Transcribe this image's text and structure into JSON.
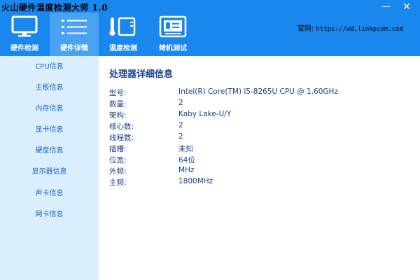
{
  "app": {
    "title": "火山硬件温度检测大师 1.0"
  },
  "window_controls": {
    "minimize": "—",
    "close": "✕"
  },
  "nav": {
    "tabs": [
      {
        "label": "硬件检测",
        "icon": "monitor-icon",
        "active": false
      },
      {
        "label": "硬件详情",
        "icon": "list-icon",
        "active": true
      },
      {
        "label": "温度检测",
        "icon": "thermometer-icon",
        "active": false
      },
      {
        "label": "烤机测试",
        "icon": "circuit-board-icon",
        "active": false
      }
    ]
  },
  "website": {
    "label": "官网:",
    "url": "https://wd.linkpcem.com"
  },
  "sidebar": {
    "items": [
      {
        "label": "CPU信息"
      },
      {
        "label": "主板信息"
      },
      {
        "label": "内存信息"
      },
      {
        "label": "显卡信息"
      },
      {
        "label": "硬盘信息"
      },
      {
        "label": "显示器信息"
      },
      {
        "label": "声卡信息"
      },
      {
        "label": "网卡信息"
      }
    ]
  },
  "main": {
    "title": "处理器详细信息",
    "rows": [
      {
        "key": "型号:",
        "value": "Intel(R) Core(TM) i5-8265U CPU @ 1.60GHz"
      },
      {
        "key": "数量:",
        "value": "2"
      },
      {
        "key": "架构:",
        "value": "Kaby Lake-U/Y"
      },
      {
        "key": "核心数:",
        "value": "2"
      },
      {
        "key": "线程数:",
        "value": "2"
      },
      {
        "key": "插槽:",
        "value": "未知"
      },
      {
        "key": "位宽:",
        "value": "64位"
      },
      {
        "key": "外频:",
        "value": "MHz"
      },
      {
        "key": "主频:",
        "value": "1800MHz"
      }
    ]
  },
  "colors": {
    "header": "#1a87ee",
    "active_tab": "#4aa2f2",
    "sidebar": "#dbeefb",
    "text": "#1a3f8a",
    "link": "#1a66c8"
  }
}
